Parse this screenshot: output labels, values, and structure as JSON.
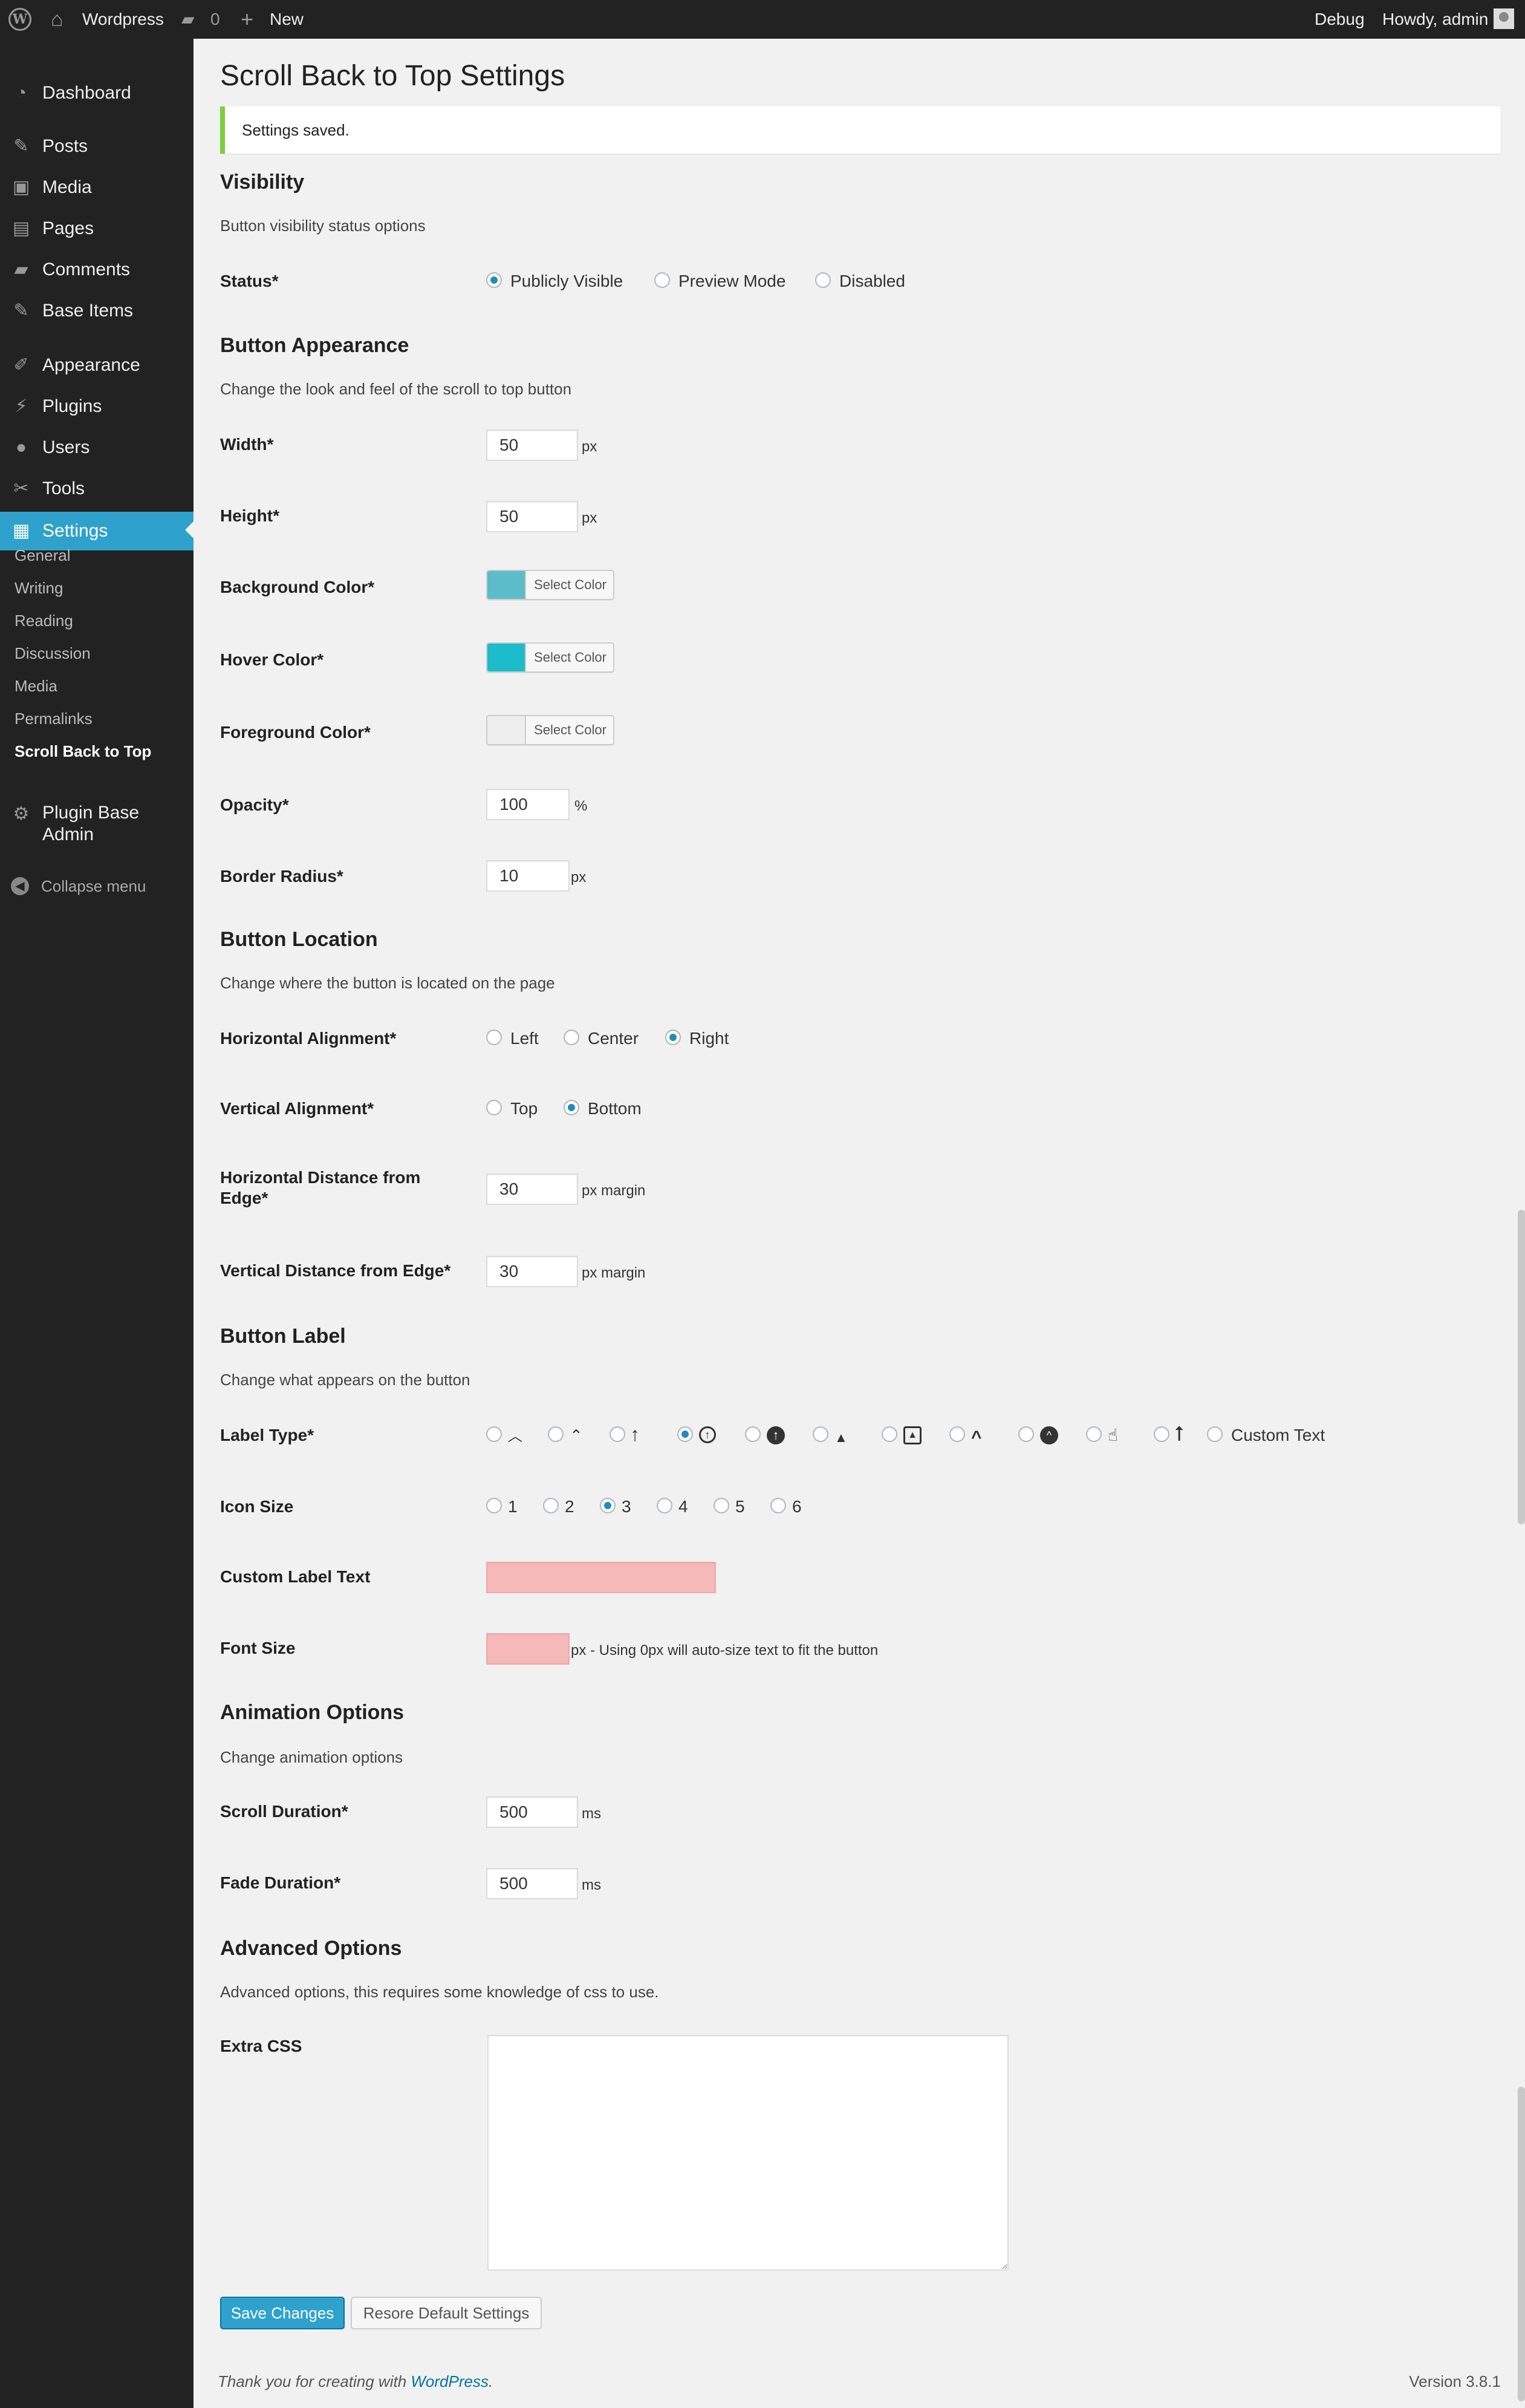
{
  "adminbar": {
    "site_name": "Wordpress",
    "comments_count": "0",
    "new_label": "New",
    "debug_label": "Debug",
    "greeting": "Howdy, admin"
  },
  "menu": {
    "items": [
      {
        "label": "Dashboard",
        "icon": "dashboard-icon"
      },
      {
        "label": "Posts",
        "icon": "pin-icon"
      },
      {
        "label": "Media",
        "icon": "media-icon"
      },
      {
        "label": "Pages",
        "icon": "pages-icon"
      },
      {
        "label": "Comments",
        "icon": "comment-icon"
      },
      {
        "label": "Base Items",
        "icon": "pin-icon"
      },
      {
        "label": "Appearance",
        "icon": "brush-icon"
      },
      {
        "label": "Plugins",
        "icon": "plug-icon"
      },
      {
        "label": "Users",
        "icon": "user-icon"
      },
      {
        "label": "Tools",
        "icon": "wrench-icon"
      },
      {
        "label": "Settings",
        "icon": "settings-icon"
      },
      {
        "label": "Plugin Base Admin",
        "icon": "gear-icon"
      }
    ],
    "submenu": [
      "General",
      "Writing",
      "Reading",
      "Discussion",
      "Media",
      "Permalinks",
      "Scroll Back to Top"
    ],
    "collapse_label": "Collapse menu"
  },
  "page": {
    "title": "Scroll Back to Top Settings",
    "notice": "Settings saved."
  },
  "visibility": {
    "title": "Visibility",
    "desc": "Button visibility status options",
    "status_label": "Status*",
    "options": [
      "Publicly Visible",
      "Preview Mode",
      "Disabled"
    ],
    "selected": "Publicly Visible"
  },
  "appearance": {
    "title": "Button Appearance",
    "desc": "Change the look and feel of the scroll to top button",
    "width_label": "Width*",
    "width_value": "50",
    "width_unit": "px",
    "height_label": "Height*",
    "height_value": "50",
    "height_unit": "px",
    "bg_label": "Background Color*",
    "bg_color": "#5bbdc9",
    "hover_label": "Hover Color*",
    "hover_color": "#1cbccb",
    "fg_label": "Foreground Color*",
    "fg_color": "#eeeeee",
    "select_color": "Select Color",
    "opacity_label": "Opacity*",
    "opacity_value": "100",
    "opacity_unit": "%",
    "radius_label": "Border Radius*",
    "radius_value": "10",
    "radius_unit": "px"
  },
  "location": {
    "title": "Button Location",
    "desc": "Change where the button is located on the page",
    "h_align_label": "Horizontal Alignment*",
    "h_options": [
      "Left",
      "Center",
      "Right"
    ],
    "h_selected": "Right",
    "v_align_label": "Vertical Alignment*",
    "v_options": [
      "Top",
      "Bottom"
    ],
    "v_selected": "Bottom",
    "h_dist_label": "Horizontal Distance from Edge*",
    "h_dist_value": "30",
    "v_dist_label": "Vertical Distance from Edge*",
    "v_dist_value": "30",
    "margin_unit": "px margin"
  },
  "label": {
    "title": "Button Label",
    "desc": "Change what appears on the button",
    "type_label": "Label Type*",
    "types": [
      "chevron-up-icon",
      "double-chevron-up-icon",
      "arrow-up-icon",
      "circle-arrow-up-icon",
      "circle-filled-arrow-up-icon",
      "triangle-up-icon",
      "square-arrow-up-icon",
      "bold-chevron-up-icon",
      "circle-chevron-up-icon",
      "hand-pointer-icon",
      "long-arrow-up-icon",
      "Custom Text"
    ],
    "type_selected": 3,
    "size_label": "Icon Size",
    "sizes": [
      "1",
      "2",
      "3",
      "4",
      "5",
      "6"
    ],
    "size_selected": "3",
    "custom_text_label": "Custom Label Text",
    "custom_text_value": "",
    "font_size_label": "Font Size",
    "font_size_value": "",
    "font_size_hint": "px - Using 0px will auto-size text to fit the button"
  },
  "animation": {
    "title": "Animation Options",
    "desc": "Change animation options",
    "scroll_label": "Scroll Duration*",
    "scroll_value": "500",
    "fade_label": "Fade Duration*",
    "fade_value": "500",
    "unit": "ms"
  },
  "advanced": {
    "title": "Advanced Options",
    "desc": "Advanced options, this requires some knowledge of css to use.",
    "css_label": "Extra CSS"
  },
  "buttons": {
    "save": "Save Changes",
    "reset": "Resore Default Settings"
  },
  "footer": {
    "thanks_prefix": "Thank you for creating with",
    "link": "WordPress",
    "suffix": ".",
    "version": "Version 3.8.1"
  }
}
